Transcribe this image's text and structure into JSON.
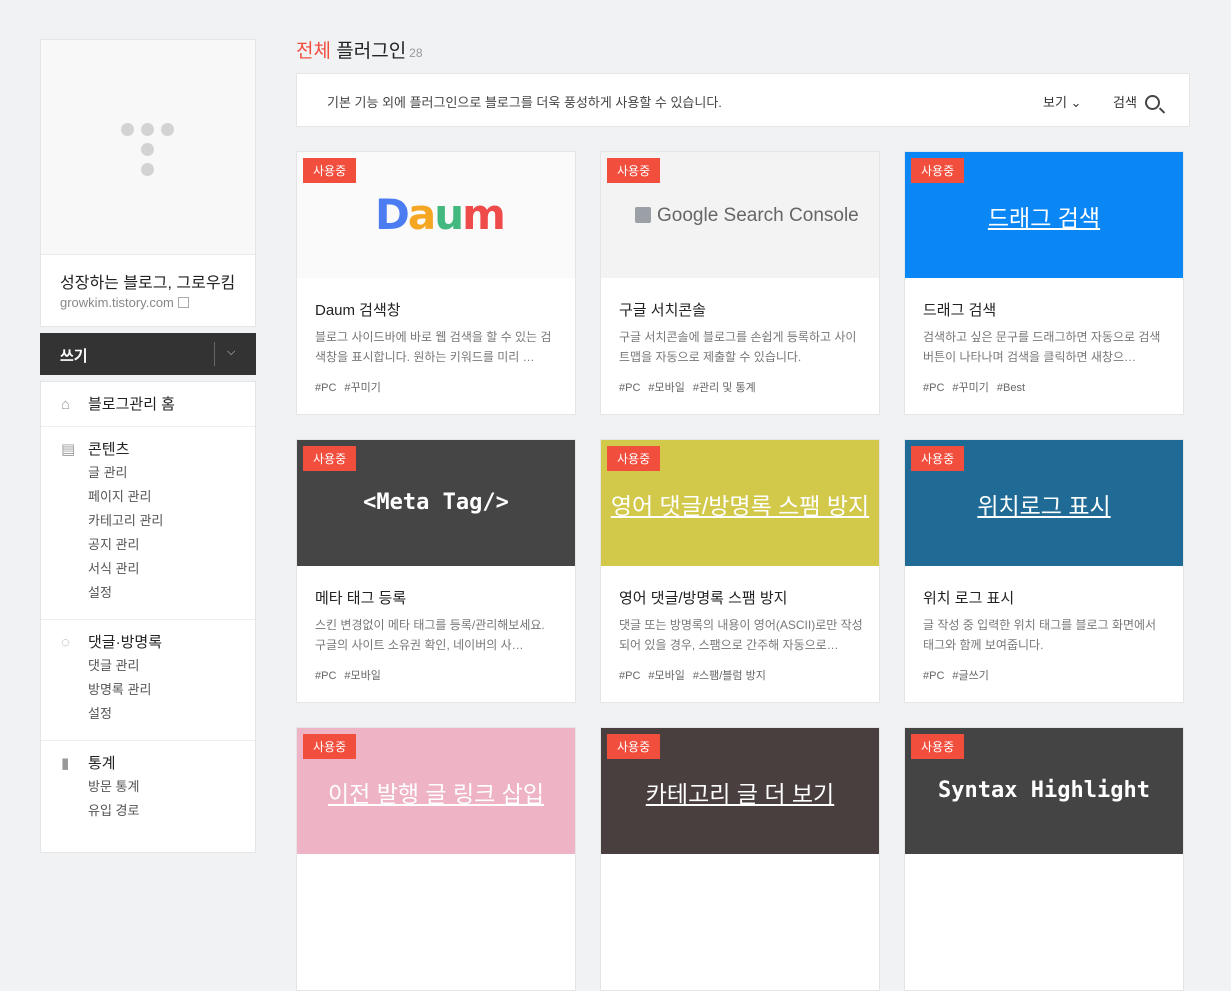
{
  "sidebar": {
    "blog_name": "성장하는 블로그, 그로우킴",
    "blog_url": "growkim.tistory.com",
    "write_label": "쓰기",
    "menu": {
      "home": "블로그관리 홈",
      "contents": {
        "title": "콘텐츠",
        "items": [
          "글 관리",
          "페이지 관리",
          "카테고리 관리",
          "공지 관리",
          "서식 관리",
          "설정"
        ]
      },
      "comments": {
        "title": "댓글·방명록",
        "items": [
          "댓글 관리",
          "방명록 관리",
          "설정"
        ]
      },
      "stats": {
        "title": "통계",
        "items": [
          "방문 통계",
          "유입 경로"
        ]
      }
    }
  },
  "header": {
    "title_accent": "전체",
    "title": "플러그인",
    "count": "28",
    "info": "기본 기능 외에 플러그인으로 블로그를 더욱 풍성하게 사용할 수 있습니다.",
    "view_label": "보기",
    "search_label": "검색"
  },
  "badge_label": "사용중",
  "cards": [
    {
      "thumb_text": "Daum",
      "title": "Daum 검색창",
      "desc": "블로그 사이드바에 바로 웹 검색을 할 수 있는 검색창을 표시합니다. 원하는 키워드를 미리 …",
      "tags": [
        "#PC",
        "#꾸미기"
      ]
    },
    {
      "thumb_text": "Google Search Console",
      "title": "구글 서치콘솔",
      "desc": "구글 서치콘솔에 블로그를 손쉽게 등록하고 사이트맵을 자동으로 제출할 수 있습니다.",
      "tags": [
        "#PC",
        "#모바일",
        "#관리 및 통계"
      ]
    },
    {
      "thumb_text": "드래그 검색",
      "title": "드래그 검색",
      "desc": "검색하고 싶은 문구를 드래그하면 자동으로 검색 버튼이 나타나며 검색을 클릭하면 새창으…",
      "tags": [
        "#PC",
        "#꾸미기",
        "#Best"
      ]
    },
    {
      "thumb_text": "<Meta Tag/>",
      "title": "메타 태그 등록",
      "desc": "스킨 변경없이 메타 태그를 등록/관리해보세요. 구글의 사이트 소유권 확인, 네이버의 사…",
      "tags": [
        "#PC",
        "#모바일"
      ]
    },
    {
      "thumb_text": "영어 댓글/방명록 스팸 방지",
      "title": "영어 댓글/방명록 스팸 방지",
      "desc": "댓글 또는 방명록의 내용이 영어(ASCII)로만 작성되어 있을 경우, 스팸으로 간주해 자동으로…",
      "tags": [
        "#PC",
        "#모바일",
        "#스팸/블럼 방지"
      ]
    },
    {
      "thumb_text": "위치로그 표시",
      "title": "위치 로그 표시",
      "desc": "글 작성 중 입력한 위치 태그를 블로그 화면에서 태그와 함께 보여줍니다.",
      "tags": [
        "#PC",
        "#글쓰기"
      ]
    },
    {
      "thumb_text": "이전 발행 글 링크 삽입",
      "title": "",
      "desc": "",
      "tags": []
    },
    {
      "thumb_text": "카테고리 글 더 보기",
      "title": "",
      "desc": "",
      "tags": []
    },
    {
      "thumb_text": "Syntax Highlight",
      "title": "",
      "desc": "",
      "tags": []
    }
  ],
  "colors": {
    "accent": "#f24e3e",
    "thumb_daum": "#fafafa",
    "thumb_gsc": "#f3f3f3",
    "thumb_drag": "#0b86f5",
    "thumb_meta": "#454545",
    "thumb_spam": "#d2c84a",
    "thumb_loc": "#1f6b96",
    "thumb_prev": "#eeb3c5",
    "thumb_cat": "#4a3f3f",
    "thumb_syntax": "#444444"
  }
}
